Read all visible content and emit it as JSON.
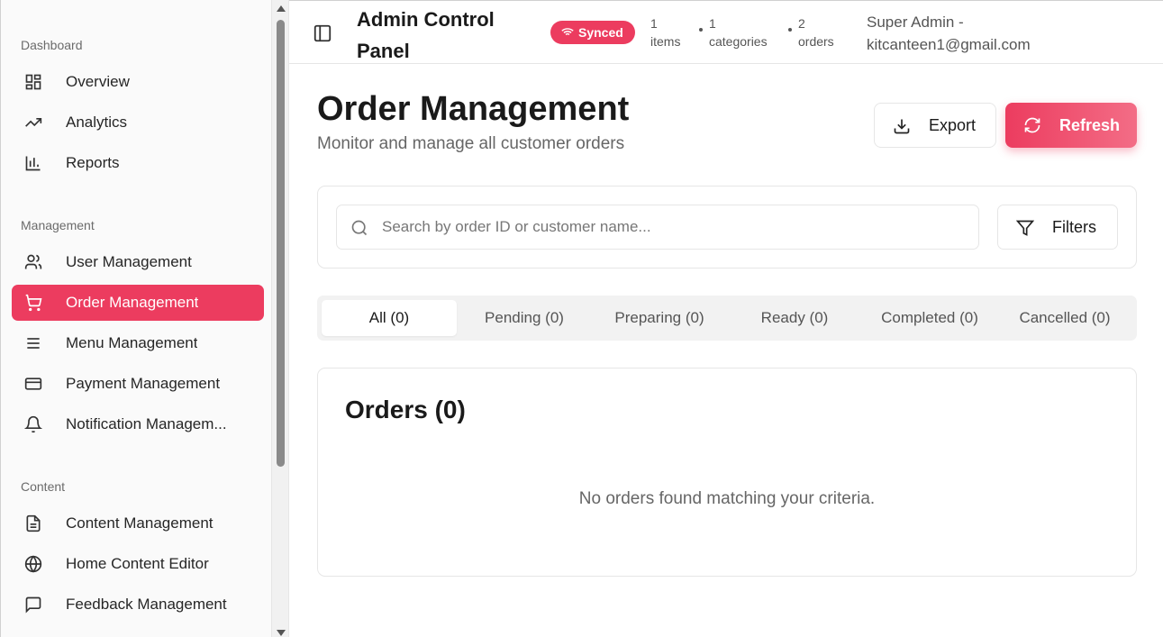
{
  "sidebar": {
    "sections": [
      {
        "label": "Dashboard"
      },
      {
        "label": "Management"
      },
      {
        "label": "Content"
      }
    ],
    "items": [
      {
        "label": "Overview",
        "icon": "grid-icon"
      },
      {
        "label": "Analytics",
        "icon": "trending-up-icon"
      },
      {
        "label": "Reports",
        "icon": "bar-chart-icon"
      },
      {
        "label": "User Management",
        "icon": "users-icon"
      },
      {
        "label": "Order Management",
        "icon": "cart-icon",
        "active": true
      },
      {
        "label": "Menu Management",
        "icon": "menu-icon"
      },
      {
        "label": "Payment Management",
        "icon": "credit-card-icon"
      },
      {
        "label": "Notification Managem...",
        "icon": "bell-icon"
      },
      {
        "label": "Content Management",
        "icon": "file-text-icon"
      },
      {
        "label": "Home Content Editor",
        "icon": "globe-icon"
      },
      {
        "label": "Feedback Management",
        "icon": "message-icon"
      }
    ]
  },
  "header": {
    "title": "Admin Control Panel",
    "sync_status": "Synced",
    "stats": [
      {
        "count": "1",
        "label": "items"
      },
      {
        "count": "1",
        "label": "categories"
      },
      {
        "count": "2",
        "label": "orders"
      }
    ],
    "user_role": "Super Admin -",
    "user_email": "kitcanteen1@gmail.com"
  },
  "main": {
    "title": "Order Management",
    "subtitle": "Monitor and manage all customer orders",
    "export_label": "Export",
    "refresh_label": "Refresh",
    "search_placeholder": "Search by order ID or customer name...",
    "filters_label": "Filters",
    "tabs": [
      {
        "label": "All (0)",
        "active": true
      },
      {
        "label": "Pending (0)"
      },
      {
        "label": "Preparing (0)"
      },
      {
        "label": "Ready (0)"
      },
      {
        "label": "Completed (0)"
      },
      {
        "label": "Cancelled (0)"
      }
    ],
    "orders_title": "Orders (0)",
    "empty_message": "No orders found matching your criteria."
  },
  "colors": {
    "accent": "#ec3c5f",
    "accent_light": "#f36d86"
  }
}
